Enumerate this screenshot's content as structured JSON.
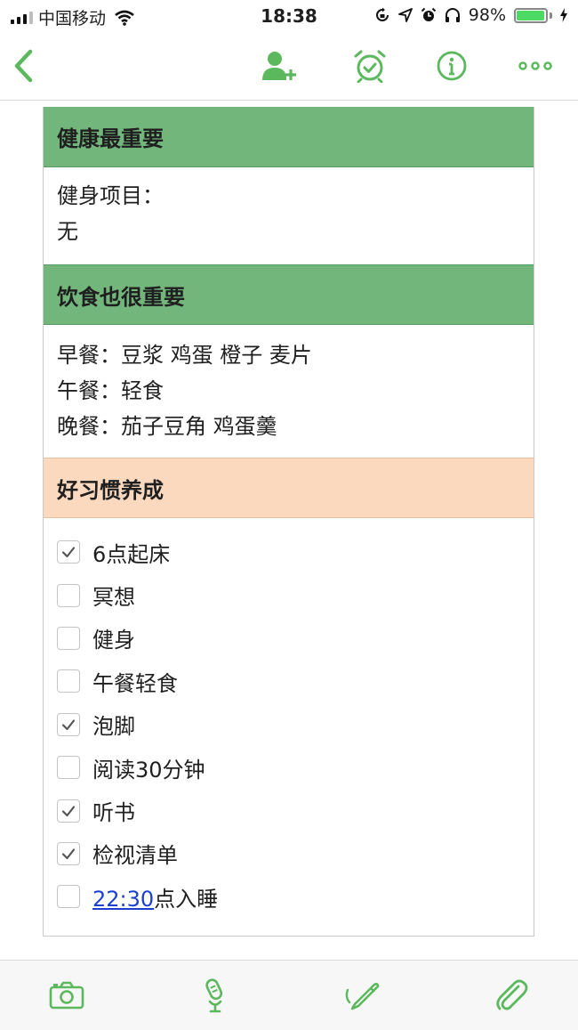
{
  "status_bar": {
    "carrier": "中国移动",
    "time": "18:38",
    "battery": "98%",
    "battery_level": 0.98
  },
  "nav": {
    "icons": [
      "chevron-left-icon",
      "add-user-icon",
      "alarm-clock-icon",
      "info-icon",
      "more-icon"
    ]
  },
  "sections": {
    "health": {
      "title": "健康最重要",
      "lines": [
        "健身项目：",
        "无"
      ]
    },
    "diet": {
      "title": "饮食也很重要",
      "lines": [
        "早餐：豆浆 鸡蛋 橙子 麦片",
        "午餐：轻食",
        "晚餐：茄子豆角 鸡蛋羹"
      ]
    },
    "habits": {
      "title": "好习惯养成",
      "items": [
        {
          "label": "6点起床",
          "checked": true
        },
        {
          "label": "冥想",
          "checked": false
        },
        {
          "label": "健身",
          "checked": false
        },
        {
          "label": "午餐轻食",
          "checked": false
        },
        {
          "label": "泡脚",
          "checked": true
        },
        {
          "label": "阅读30分钟",
          "checked": false
        },
        {
          "label": "听书",
          "checked": true
        },
        {
          "label": "检视清单",
          "checked": true
        },
        {
          "link": "22:30",
          "label": "点入睡",
          "checked": false
        }
      ]
    }
  },
  "toolbar": {
    "icons": [
      "camera-icon",
      "microphone-icon",
      "pen-icon",
      "paperclip-icon"
    ]
  },
  "colors": {
    "accent": "#5cb85c",
    "section_green": "#72b67c",
    "section_peach": "#fad9bf",
    "link": "#1a3fd1"
  }
}
